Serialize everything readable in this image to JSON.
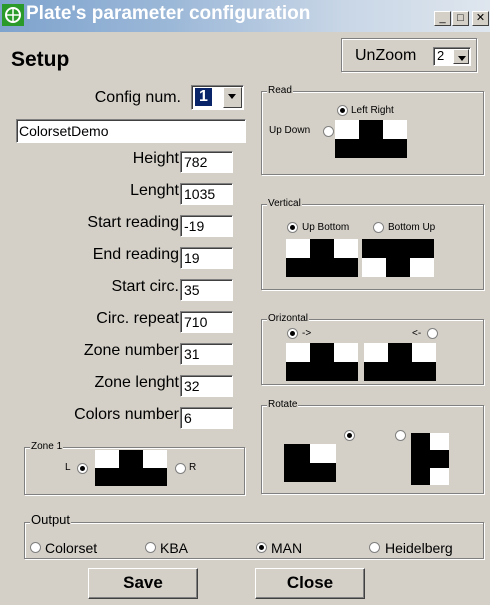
{
  "window": {
    "title": "Plate's parameter configuration",
    "minimize": "_",
    "maximize": "□",
    "close": "✕"
  },
  "setup_title": "Setup",
  "unzoom": {
    "label": "UnZoom",
    "value": "2"
  },
  "config": {
    "label": "Config num.",
    "value": "1"
  },
  "name_value": "ColorsetDemo",
  "fields": [
    {
      "label": "Height",
      "value": "782"
    },
    {
      "label": "Lenght",
      "value": "1035"
    },
    {
      "label": "Start reading",
      "value": "-19"
    },
    {
      "label": "End reading",
      "value": "19"
    },
    {
      "label": "Start circ.",
      "value": "35"
    },
    {
      "label": "Circ. repeat",
      "value": "710"
    },
    {
      "label": "Zone number",
      "value": "31"
    },
    {
      "label": "Zone lenght",
      "value": "32"
    },
    {
      "label": "Colors number",
      "value": "6"
    }
  ],
  "zone": {
    "title": "Zone 1",
    "left": "L",
    "right": "R",
    "selected": "left"
  },
  "read": {
    "title": "Read",
    "left_right": "Left Right",
    "up_down": "Up Down",
    "selected": "left_right"
  },
  "vertical": {
    "title": "Vertical",
    "up_bottom": "Up Bottom",
    "bottom_up": "Bottom Up",
    "selected": "up_bottom"
  },
  "orizontal": {
    "title": "Orizontal",
    "forward": "->",
    "backward": "<-",
    "selected": "forward"
  },
  "rotate": {
    "title": "Rotate",
    "selected": "first"
  },
  "output": {
    "title": "Output",
    "options": [
      "Colorset",
      "KBA",
      "MAN",
      "Heidelberg"
    ],
    "selected": "MAN"
  },
  "buttons": {
    "save": "Save",
    "close": "Close"
  }
}
